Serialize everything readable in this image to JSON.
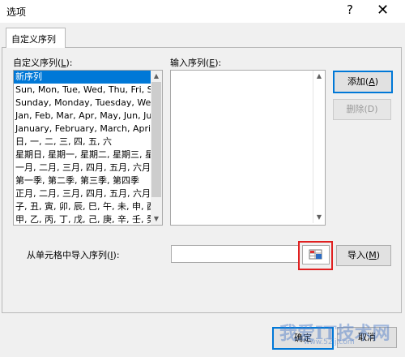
{
  "window": {
    "title": "选项",
    "help_glyph": "?",
    "close_glyph": "✕"
  },
  "tab": {
    "label": "自定义序列"
  },
  "custom_list": {
    "label_text": "自定义序列(",
    "label_key": "L",
    "label_end": "):",
    "items": [
      "新序列",
      "Sun, Mon, Tue, Wed, Thu, Fri, S",
      "Sunday, Monday, Tuesday, Wed",
      "Jan, Feb, Mar, Apr, May, Jun, Ju",
      "January, February, March, April,",
      "日, 一, 二, 三, 四, 五, 六",
      "星期日, 星期一, 星期二, 星期三, 星",
      "一月, 二月, 三月, 四月, 五月, 六月,",
      "第一季, 第二季, 第三季, 第四季",
      "正月, 二月, 三月, 四月, 五月, 六月,",
      "子, 丑, 寅, 卯, 辰, 巳, 午, 未, 申, 酉",
      "甲, 乙, 丙, 丁, 戊, 己, 庚, 辛, 壬, 癸"
    ],
    "selected_index": 0
  },
  "entries": {
    "label_text": "输入序列(",
    "label_key": "E",
    "label_end": "):",
    "value": ""
  },
  "buttons": {
    "add_text": "添加(",
    "add_key": "A",
    "add_end": ")",
    "delete_text": "删除(D)",
    "import_text": "导入(",
    "import_key": "M",
    "import_end": ")",
    "ok": "确定",
    "cancel": "取消"
  },
  "import": {
    "label_text": "从单元格中导入序列(",
    "label_key": "I",
    "label_end": "):",
    "value": ""
  },
  "watermark": {
    "main": "我爱IT技术网",
    "sub": "www.52ij.com"
  },
  "colors": {
    "accent": "#0078d7",
    "highlight_box": "#e02020",
    "selection": "#0078d7"
  }
}
